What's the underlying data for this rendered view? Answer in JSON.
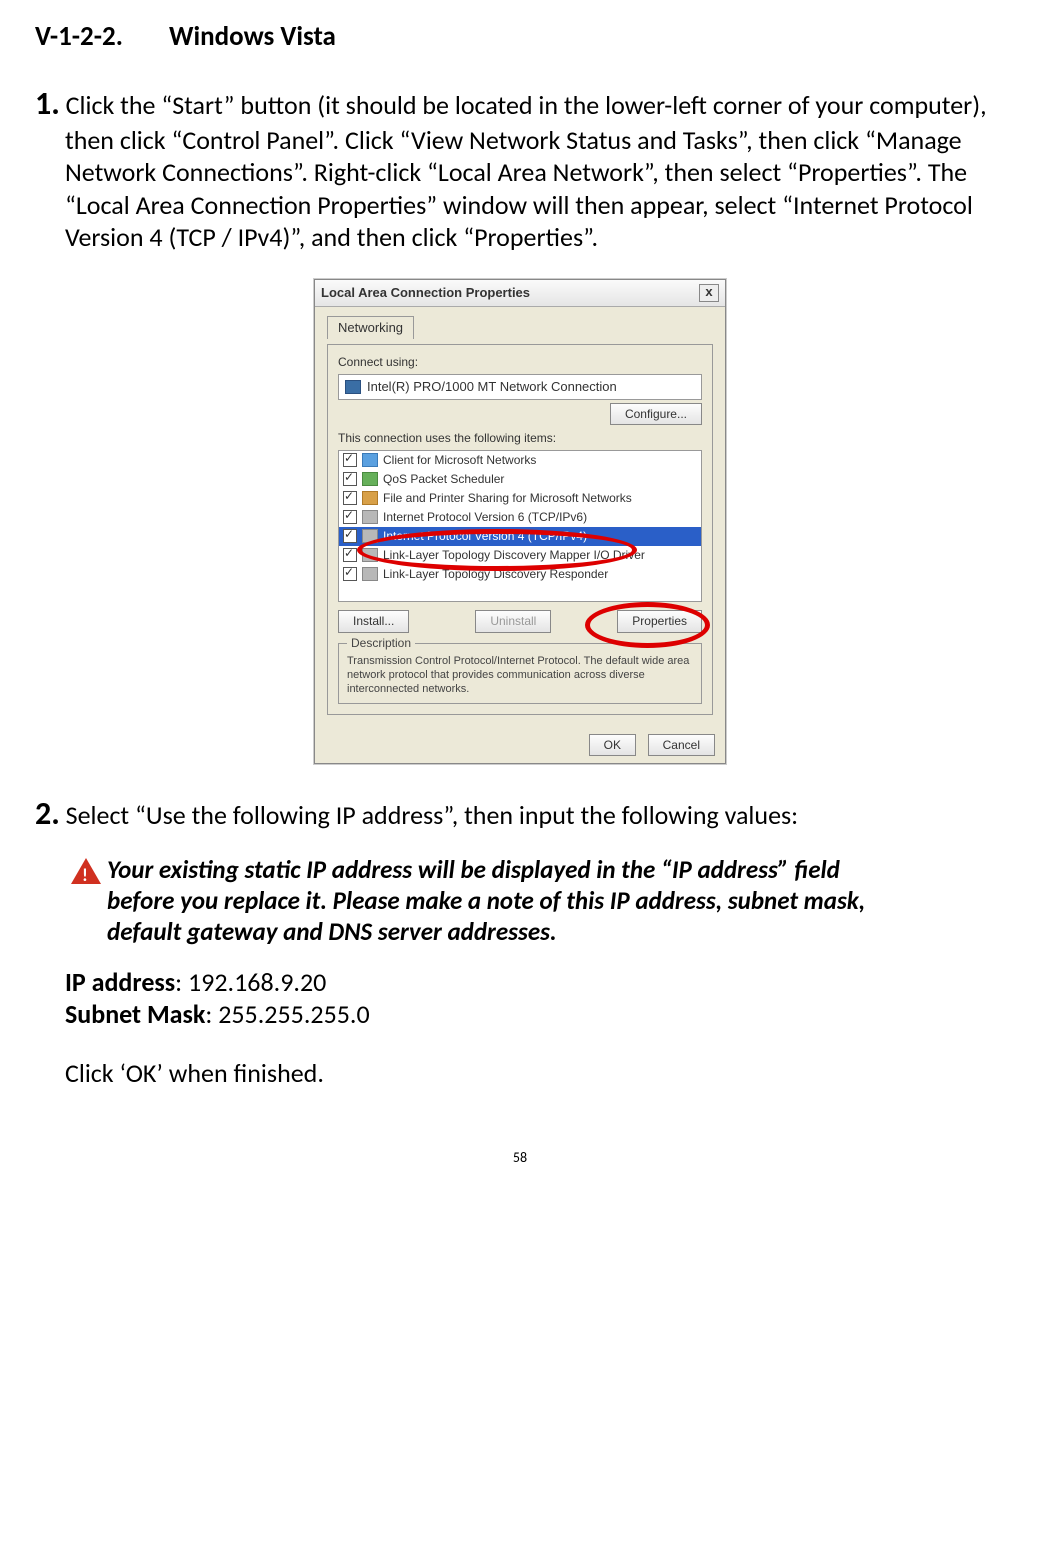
{
  "heading": {
    "number": "V-1-2-2.",
    "title": "Windows Vista"
  },
  "step1": {
    "num": "1.",
    "text": "Click the “Start” button (it should be located in the lower-left corner of your computer), then click “Control Panel”. Click “View Network Status and Tasks”, then click “Manage Network Connections”. Right-click “Local Area Network”, then select “Properties”. The “Local Area Connection Properties” window will then appear, select “Internet Protocol Version 4 (TCP / IPv4)”, and then click “Properties”."
  },
  "dialog": {
    "title": "Local Area Connection Properties",
    "close": "x",
    "tab": "Networking",
    "connect_label": "Connect using:",
    "adapter": "Intel(R) PRO/1000 MT Network Connection",
    "configure": "Configure...",
    "items_label": "This connection uses the following items:",
    "items": [
      "Client for Microsoft Networks",
      "QoS Packet Scheduler",
      "File and Printer Sharing for Microsoft Networks",
      "Internet Protocol Version 6 (TCP/IPv6)",
      "Internet Protocol Version 4 (TCP/IPv4)",
      "Link-Layer Topology Discovery Mapper I/O Driver",
      "Link-Layer Topology Discovery Responder"
    ],
    "install": "Install...",
    "uninstall": "Uninstall",
    "properties": "Properties",
    "desc_title": "Description",
    "desc_text": "Transmission Control Protocol/Internet Protocol. The default wide area network protocol that provides communication across diverse interconnected networks.",
    "ok": "OK",
    "cancel": "Cancel"
  },
  "step2": {
    "num": "2.",
    "text": "Select “Use the following IP address”, then input the following values:"
  },
  "warning": "Your existing static IP address will be displayed in the “IP address” field before you replace it. Please make a note of this IP address, subnet mask, default gateway and DNS server addresses.",
  "net": {
    "ip_label": "IP address",
    "ip_value": ": 192.168.9.20",
    "mask_label": "Subnet Mask",
    "mask_value": ": 255.255.255.0",
    "finish": "Click ‘OK’ when finished."
  },
  "page_number": "58"
}
